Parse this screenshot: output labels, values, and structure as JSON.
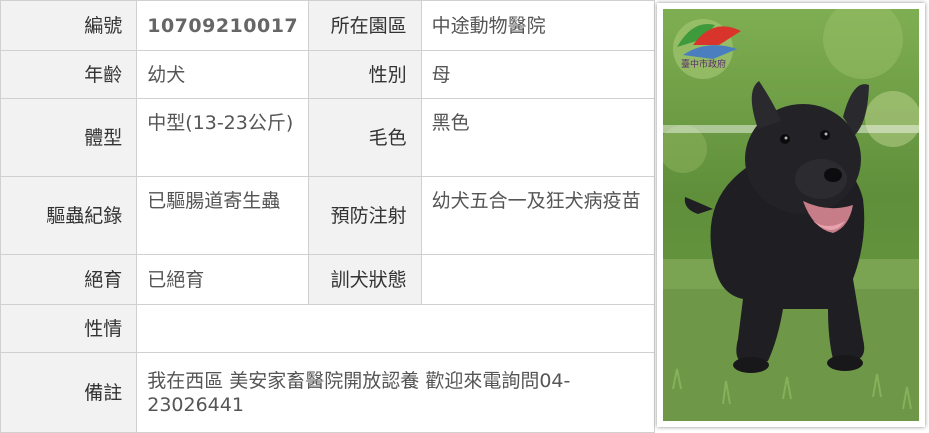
{
  "rows": {
    "id": {
      "label": "編號",
      "value": "10709210017"
    },
    "shelter": {
      "label": "所在園區",
      "value": "中途動物醫院"
    },
    "age": {
      "label": "年齡",
      "value": "幼犬"
    },
    "sex": {
      "label": "性別",
      "value": "母"
    },
    "size": {
      "label": "體型",
      "value": "中型(13-23公斤)"
    },
    "coat": {
      "label": "毛色",
      "value": "黑色"
    },
    "deworm": {
      "label": "驅蟲紀錄",
      "value": "已驅腸道寄生蟲"
    },
    "vaccine": {
      "label": "預防注射",
      "value": "幼犬五合一及狂犬病疫苗"
    },
    "neuter": {
      "label": "絕育",
      "value": "已絕育"
    },
    "training": {
      "label": "訓犬狀態",
      "value": ""
    },
    "temperament": {
      "label": "性情",
      "value": ""
    },
    "notes": {
      "label": "備註",
      "value": "我在西區 美安家畜醫院開放認養 歡迎來電詢問04-23026441"
    }
  },
  "photo": {
    "watermark_text": "臺中市政府",
    "colors": {
      "grass": "#6e9a45",
      "dog": "#1e1e22",
      "logo_red": "#d9342b",
      "logo_green": "#3f9a3c"
    }
  }
}
